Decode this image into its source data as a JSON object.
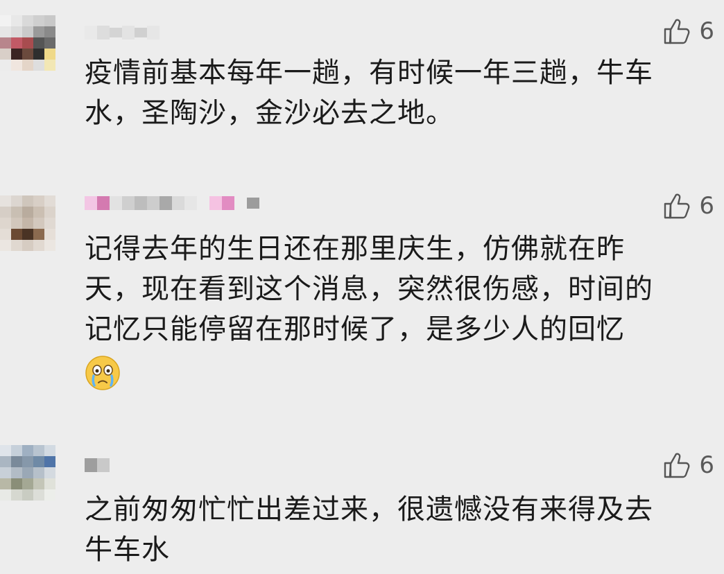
{
  "comments": [
    {
      "likes": "6",
      "text_lines": [
        "疫情前基本每年一趟，有时候一年三趟，牛车",
        "水，圣陶沙，金沙必去之地。"
      ]
    },
    {
      "likes": "6",
      "text_lines": [
        "记得去年的生日还在那里庆生，仿佛就在昨",
        "天，现在看到这个消息，突然很伤感，时间的",
        "记忆只能停留在那时候了，是多少人的回忆"
      ],
      "emoji": "crying-face-emoji"
    },
    {
      "likes": "6",
      "text_lines": [
        "之前匆匆忙忙出差过来，很遗憾没有来得及去",
        "牛车水"
      ]
    }
  ],
  "icons": {
    "like": "thumbs-up-outline-icon"
  },
  "colors": {
    "background": "#ededed",
    "text": "#1a1a1a",
    "like_text": "#5a5a5a"
  }
}
